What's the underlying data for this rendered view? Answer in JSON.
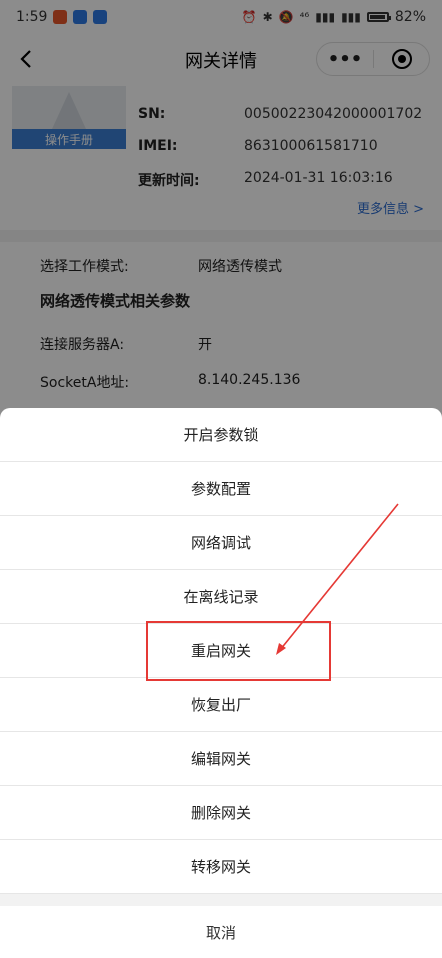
{
  "status_bar": {
    "time": "1:59",
    "network": "⁴⁶",
    "battery": "82%",
    "battery_level": 0.82
  },
  "nav": {
    "title": "网关详情",
    "back_icon": "back-arrow-icon",
    "more_icon": "more-dots-icon",
    "target_icon": "target-icon"
  },
  "device": {
    "manual_label": "操作手册",
    "fields": [
      {
        "label": "SN:",
        "value": "00500223042000001702"
      },
      {
        "label": "IMEI:",
        "value": "863100061581710"
      },
      {
        "label": "更新时间:",
        "value": "2024-01-31 16:03:16"
      }
    ],
    "more_info": "更多信息 >"
  },
  "params": {
    "mode_label": "选择工作模式:",
    "mode_value": "网络透传模式",
    "section_title": "网络透传模式相关参数",
    "rows": [
      {
        "label": "连接服务器A:",
        "value": "开"
      },
      {
        "label": "SocketA地址:",
        "value": "8.140.245.136"
      }
    ]
  },
  "action_sheet": {
    "items": [
      "开启参数锁",
      "参数配置",
      "网络调试",
      "在离线记录",
      "重启网关",
      "恢复出厂",
      "编辑网关",
      "删除网关",
      "转移网关"
    ],
    "cancel": "取消"
  },
  "colors": {
    "accent_blue": "#3b7fd3",
    "link_blue": "#2c6ccf",
    "annotation_red": "#e53935"
  }
}
